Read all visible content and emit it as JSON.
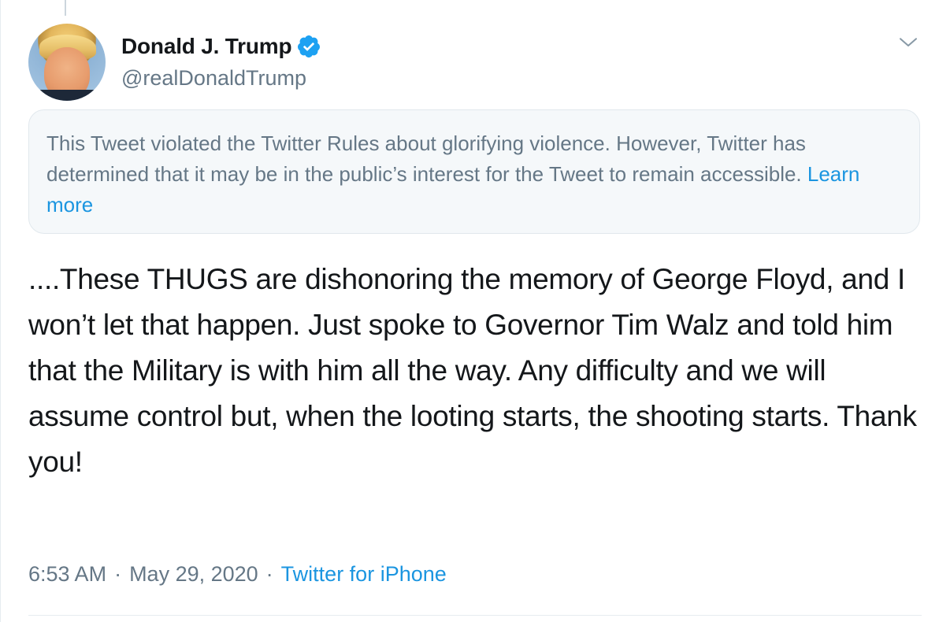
{
  "tweet": {
    "author": {
      "display_name": "Donald J. Trump",
      "handle": "@realDonaldTrump",
      "verified": true,
      "avatar_icon": "profile-photo"
    },
    "notice": {
      "text": "This Tweet violated the Twitter Rules about glorifying violence. However, Twitter has determined that it may be in the public’s interest for the Tweet to remain accessible. ",
      "link_label": "Learn more"
    },
    "text": "....These THUGS are dishonoring the memory of George Floyd, and I won’t let that happen. Just spoke to Governor Tim Walz and told him that the Military is with him all the way. Any difficulty and we will assume control but, when the looting starts, the shooting starts. Thank you!",
    "time": "6:53 AM",
    "separator": "·",
    "date": "May 29, 2020",
    "source": "Twitter for iPhone"
  },
  "icons": {
    "verified": "verified-badge-icon",
    "menu": "chevron-down-icon"
  },
  "colors": {
    "accent": "#1b95e0",
    "verified": "#1da1f2",
    "secondary_text": "#657786",
    "primary_text": "#14171a",
    "notice_bg": "#f5f8fa",
    "border": "#e1e8ed"
  }
}
